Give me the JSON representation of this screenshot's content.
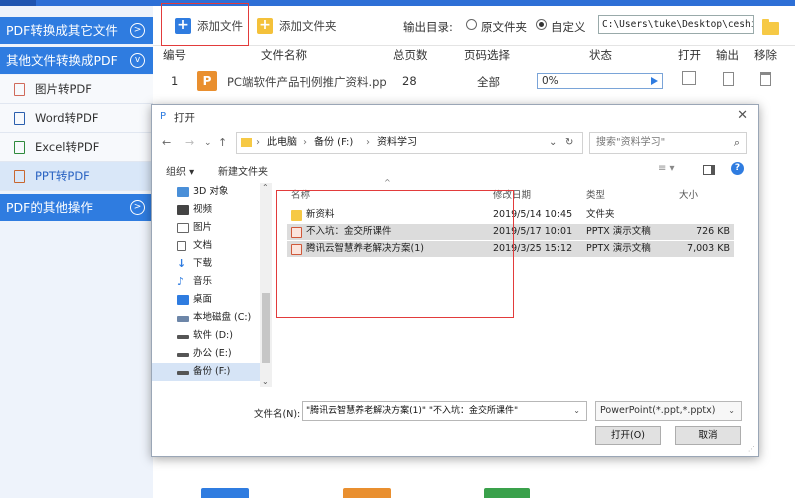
{
  "sidebar": {
    "sections": [
      {
        "label": "PDF转换成其它文件"
      },
      {
        "label": "其他文件转换成PDF"
      },
      {
        "label": "PDF的其他操作"
      }
    ],
    "items": [
      {
        "label": "图片转PDF"
      },
      {
        "label": "Word转PDF"
      },
      {
        "label": "Excel转PDF"
      },
      {
        "label": "PPT转PDF"
      }
    ]
  },
  "toolbar": {
    "add_file": "添加文件",
    "add_folder": "添加文件夹",
    "output_label": "输出目录:",
    "radio_source": "原文件夹",
    "radio_custom": "自定义",
    "output_path": "C:\\Users\\tuke\\Desktop\\ceshi"
  },
  "table": {
    "headers": [
      "编号",
      "文件名称",
      "总页数",
      "页码选择",
      "状态",
      "打开",
      "输出",
      "移除"
    ],
    "rows": [
      {
        "index": "1",
        "badge": "P",
        "name": "PC端软件产品刊例推广资料.pp",
        "pages": "28",
        "page_select": "全部",
        "progress": "0%",
        "progress_value": 0
      }
    ]
  },
  "dialog": {
    "title": "打开",
    "address": [
      "此电脑",
      "备份 (F:)",
      "资料学习"
    ],
    "search_placeholder": "搜索\"资料学习\"",
    "organize": "组织 ▾",
    "new_folder": "新建文件夹",
    "nav_items": [
      {
        "label": "3D 对象",
        "icon": "3d-objects-icon"
      },
      {
        "label": "视频",
        "icon": "video-icon"
      },
      {
        "label": "图片",
        "icon": "pictures-icon"
      },
      {
        "label": "文档",
        "icon": "documents-icon"
      },
      {
        "label": "下载",
        "icon": "download-icon"
      },
      {
        "label": "音乐",
        "icon": "music-icon"
      },
      {
        "label": "桌面",
        "icon": "desktop-icon"
      },
      {
        "label": "本地磁盘 (C:)",
        "icon": "drive-icon"
      },
      {
        "label": "软件 (D:)",
        "icon": "drive-icon"
      },
      {
        "label": "办公 (E:)",
        "icon": "drive-icon"
      },
      {
        "label": "备份 (F:)",
        "icon": "drive-icon"
      }
    ],
    "columns": [
      "名称",
      "修改日期",
      "类型",
      "大小"
    ],
    "files": [
      {
        "name": "新资料",
        "date": "2019/5/14 10:45",
        "type": "文件夹",
        "size": "",
        "kind": "folder"
      },
      {
        "name": "不入坑：金交所课件",
        "date": "2019/5/17 10:01",
        "type": "PPTX 演示文稿",
        "size": "726 KB",
        "kind": "ppt"
      },
      {
        "name": "腾讯云智慧养老解决方案(1)",
        "date": "2019/3/25 15:12",
        "type": "PPTX 演示文稿",
        "size": "7,003 KB",
        "kind": "ppt"
      }
    ],
    "filename_label": "文件名(N):",
    "filename_value": "\"腾讯云智慧养老解决方案(1)\" \"不入坑：金交所课件\"",
    "filetype": "PowerPoint(*.ppt,*.pptx)",
    "open_button": "打开(O)",
    "cancel_button": "取消"
  },
  "colors": {
    "accent": "#2f7ce0",
    "highlight_box": "#e23b3b"
  }
}
